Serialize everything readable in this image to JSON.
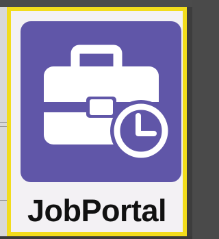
{
  "app": {
    "name": "JobPortal",
    "icon": "briefcase-clock-icon"
  },
  "colors": {
    "focus_border": "#f2dc1c",
    "tile_background": "#f3f1f4",
    "icon_background": "#6056a8",
    "icon_glyph": "#ffffff",
    "label_text": "#111111"
  }
}
